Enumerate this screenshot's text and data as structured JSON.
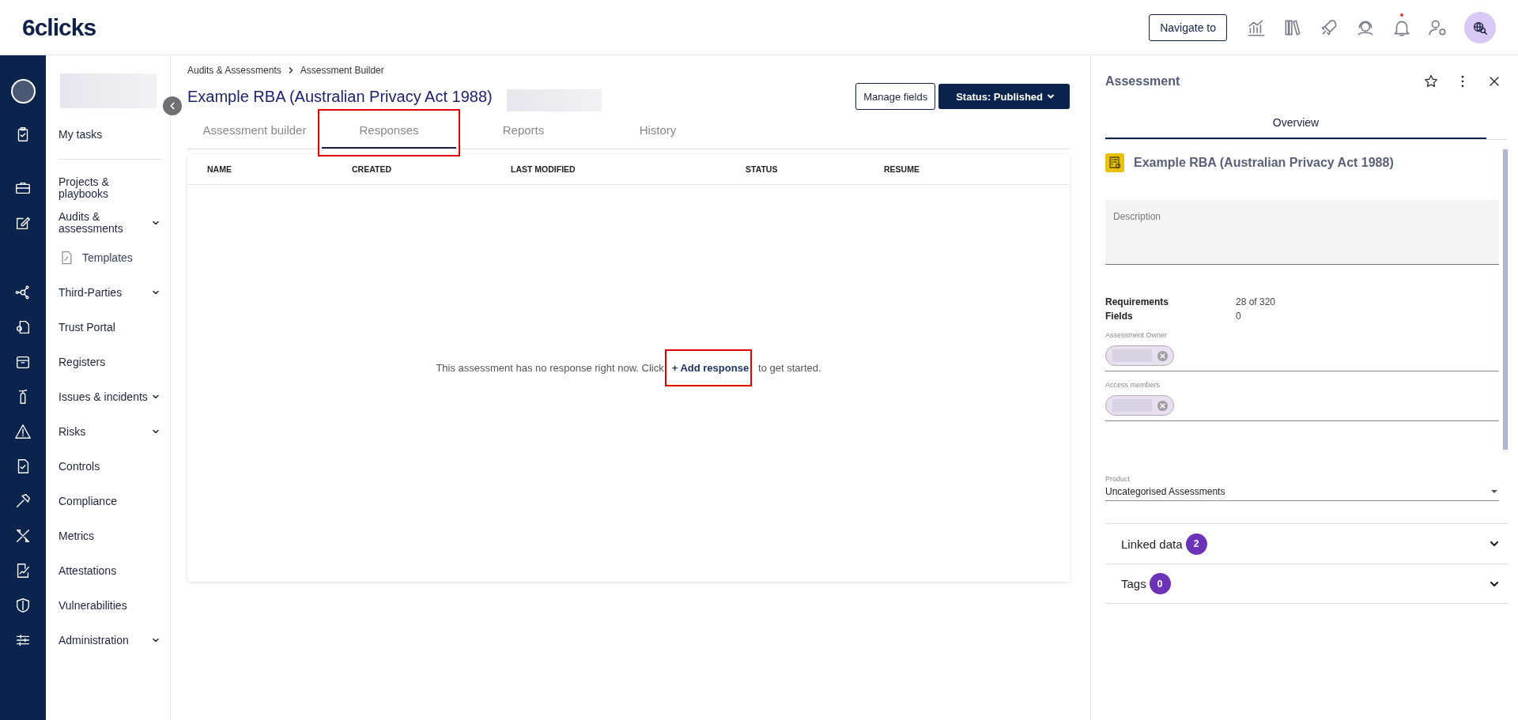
{
  "top_bar": {
    "logo": "6clicks",
    "navigate_button": "Navigate to",
    "notification_dot": true
  },
  "sidebar": {
    "items": [
      {
        "label": "My tasks",
        "kind": "item",
        "expandable": false
      },
      {
        "label": "Projects & playbooks",
        "kind": "item",
        "expandable": false
      },
      {
        "label": "Audits & assessments",
        "kind": "item",
        "expandable": true
      },
      {
        "label": "Templates",
        "kind": "subitem",
        "expandable": false
      },
      {
        "label": "Third-Parties",
        "kind": "item",
        "expandable": true
      },
      {
        "label": "Trust Portal",
        "kind": "item",
        "expandable": false
      },
      {
        "label": "Registers",
        "kind": "item",
        "expandable": false
      },
      {
        "label": "Issues & incidents",
        "kind": "item",
        "expandable": true
      },
      {
        "label": "Risks",
        "kind": "item",
        "expandable": true
      },
      {
        "label": "Controls",
        "kind": "item",
        "expandable": false
      },
      {
        "label": "Compliance",
        "kind": "item",
        "expandable": false
      },
      {
        "label": "Metrics",
        "kind": "item",
        "expandable": false
      },
      {
        "label": "Attestations",
        "kind": "item",
        "expandable": false
      },
      {
        "label": "Vulnerabilities",
        "kind": "item",
        "expandable": false
      },
      {
        "label": "Administration",
        "kind": "item",
        "expandable": true
      }
    ]
  },
  "breadcrumb": [
    "Audits & Assessments",
    "Assessment Builder"
  ],
  "page_title": "Example RBA (Australian Privacy Act 1988)",
  "actions": {
    "manage_fields": "Manage fields",
    "status": "Status: Published"
  },
  "tabs": [
    {
      "label": "Assessment builder",
      "selected": false,
      "highlighted": false
    },
    {
      "label": "Responses",
      "selected": true,
      "highlighted": true
    },
    {
      "label": "Reports",
      "selected": false,
      "highlighted": false
    },
    {
      "label": "History",
      "selected": false,
      "highlighted": false
    }
  ],
  "table": {
    "columns": [
      "NAME",
      "CREATED",
      "LAST MODIFIED",
      "STATUS",
      "RESUME"
    ],
    "empty_message": {
      "before": "This assessment has no response right now. Click",
      "link": "+ Add response",
      "after": "to get started.",
      "highlighted": true
    }
  },
  "panel": {
    "title": "Assessment",
    "tabs": [
      {
        "label": "Overview",
        "selected": true
      }
    ],
    "item_title": "Example RBA (Australian Privacy Act 1988)",
    "description": {
      "placeholder": "Description"
    },
    "stats": [
      {
        "label": "Requirements",
        "value": "28 of 320"
      },
      {
        "label": "Fields",
        "value": "0"
      }
    ],
    "owner": {
      "label": "Assessment Owner"
    },
    "members": {
      "label": "Access members"
    },
    "product": {
      "label": "Product",
      "value": "Uncategorised Assessments"
    },
    "sections": [
      {
        "label": "Linked data",
        "count": "2",
        "expanded": false
      },
      {
        "label": "Tags",
        "count": "0",
        "expanded": false
      }
    ]
  }
}
